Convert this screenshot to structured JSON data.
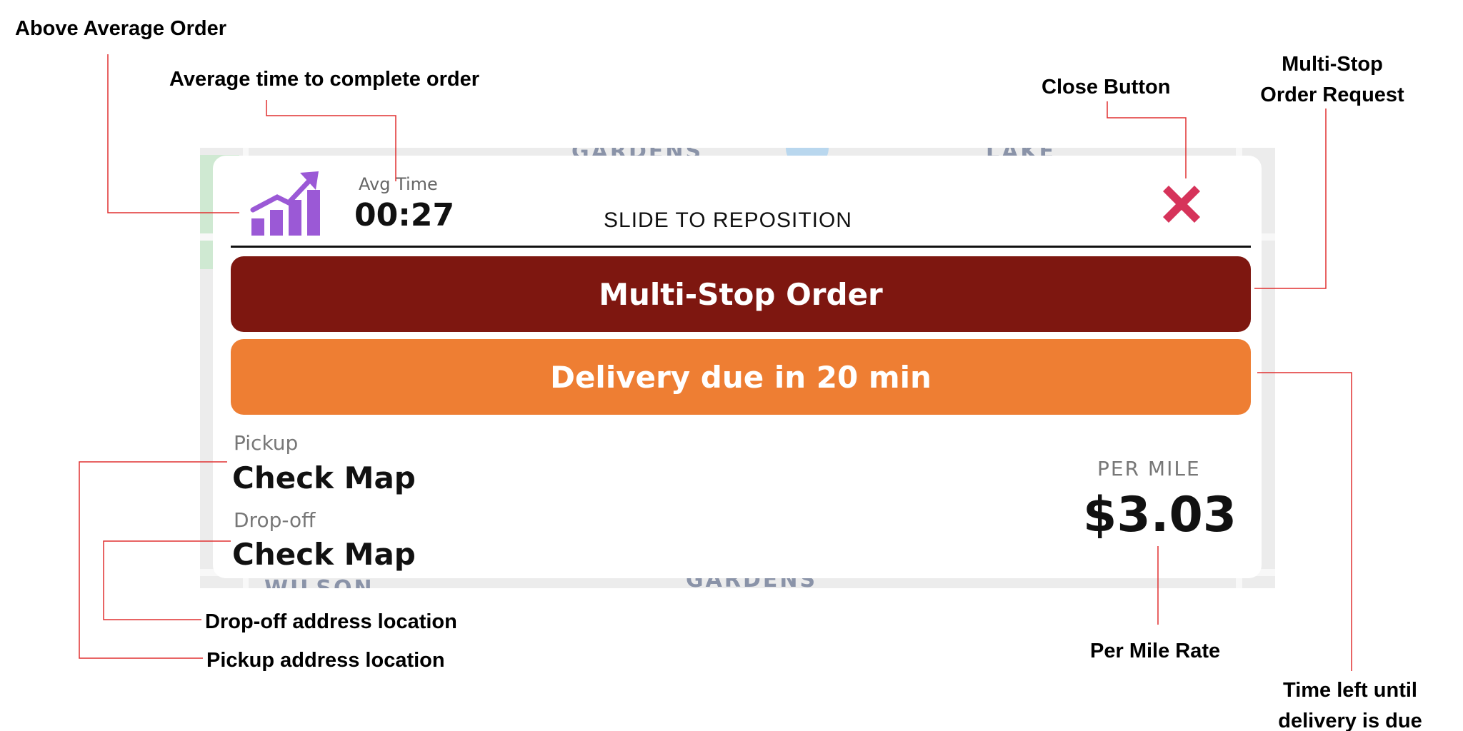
{
  "card": {
    "avg_time_label": "Avg Time",
    "avg_time_value": "00:27",
    "slide_instruction": "SLIDE TO REPOSITION",
    "order_type_banner": "Multi-Stop Order",
    "delivery_due_banner": "Delivery due in 20 min",
    "pickup_label": "Pickup",
    "pickup_value": "Check Map",
    "dropoff_label": "Drop-off",
    "dropoff_value": "Check Map",
    "per_mile_label": "PER MILE",
    "per_mile_value": "$3.03"
  },
  "annotations": {
    "above_average_order": "Above Average Order",
    "average_time": "Average time to complete order",
    "close_button": "Close Button",
    "multi_stop_line1": "Multi-Stop",
    "multi_stop_line2": "Order Request",
    "time_left_line1": "Time left until",
    "time_left_line2": "delivery is due",
    "per_mile_rate": "Per Mile Rate",
    "dropoff_address": "Drop-off address location",
    "pickup_address": "Pickup address location"
  },
  "map_labels": {
    "top_left": "GARDENS",
    "top_right": "LAKE",
    "bottom_center": "GARDENS",
    "bottom_left": "WILSON"
  },
  "colors": {
    "multi_stop_banner": "#7e1710",
    "delivery_due_banner": "#ee7e33",
    "trend_icon": "#9b59d6",
    "close_icon": "#d6335a",
    "callout_line": "#e03030"
  },
  "icons": {
    "trend": "above-average-trend-icon",
    "close": "close-x-icon"
  }
}
